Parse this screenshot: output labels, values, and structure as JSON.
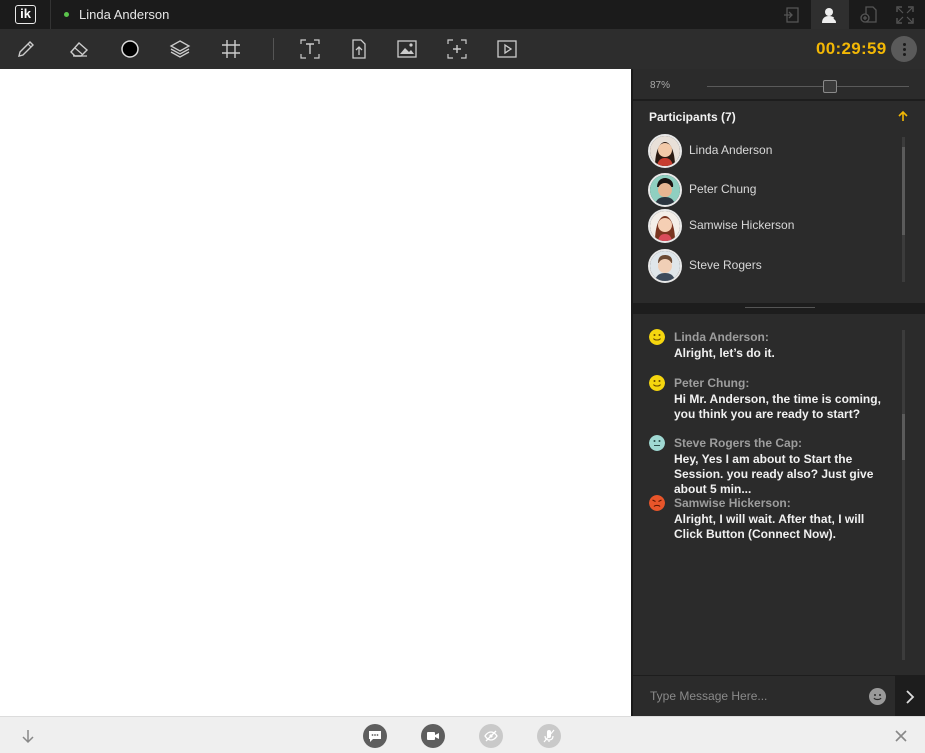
{
  "app": {
    "logo_text": "ik",
    "current_user": "Linda Anderson"
  },
  "top_icons": [
    "share-screen-icon",
    "participants-icon",
    "add-document-icon",
    "fullscreen-icon"
  ],
  "toolbar": {
    "tools": [
      "pencil-icon",
      "eraser-icon",
      "color-icon",
      "layers-icon",
      "grid-icon",
      "text-icon",
      "upload-file-icon",
      "image-icon",
      "add-frame-icon",
      "video-icon"
    ],
    "timer": "00:29:59",
    "accent_color": "#f2b705"
  },
  "zoom": {
    "label": "87%",
    "level": 0.87
  },
  "participants": {
    "title": "Participants (7)",
    "items": [
      {
        "name": "Linda Anderson"
      },
      {
        "name": "Peter Chung"
      },
      {
        "name": "Samwise Hickerson"
      },
      {
        "name": "Steve Rogers"
      }
    ]
  },
  "chat": {
    "messages": [
      {
        "author": "Linda Anderson:",
        "text": "Alright, let’s do it.",
        "mood": "happy",
        "emoji_color": "#f5d60f"
      },
      {
        "author": "Peter Chung:",
        "text": "Hi Mr. Anderson, the time is coming, you think you are ready to start?",
        "mood": "happy",
        "emoji_color": "#f5d60f"
      },
      {
        "author": "Steve Rogers the Cap:",
        "text": "Hey, Yes I am about to Start the Session. you ready also? Just give about 5 min...",
        "mood": "neutral",
        "emoji_color": "#9fd8d2"
      },
      {
        "author": "Samwise Hickerson:",
        "text": "Alright, I will wait. After that, I will Click Button (Connect Now).",
        "mood": "angry",
        "emoji_color": "#e8552a"
      }
    ],
    "input_placeholder": "Type Message Here..."
  },
  "bottom_bar": {
    "icons": [
      "collapse-down-icon",
      "chat-icon",
      "video-camera-icon",
      "hide-view-icon",
      "microphone-muted-icon",
      "close-icon"
    ]
  }
}
